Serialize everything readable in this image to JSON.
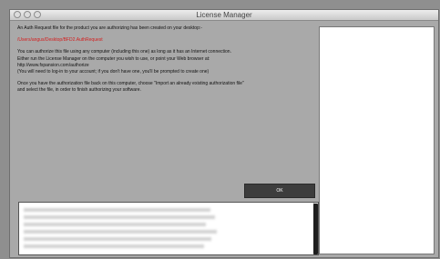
{
  "window": {
    "title": "License Manager"
  },
  "message": {
    "intro": "An Auth Request file for the product you are authorizing has been created on your desktop:-",
    "file_path": "/Users/angus/Desktop/BFD2.AuthRequest",
    "line1": "You can authorize this file using any computer (including this one) as long as it has an Internet connection.",
    "line2": "Either run the License Manager on the computer you wish to use, or point your Web browser at:",
    "url": "http://www.fxpansion.com/authorize",
    "line3": "(You will need to log-in to your account; if you don't have one, you'll be prompted to create one)",
    "line4": "Once you have the authorization file back on this computer, choose \"Import an already existing authorization file\"",
    "line5": "and select the file, in order to finish authorizing your software."
  },
  "buttons": {
    "ok_label": "OK"
  },
  "colors": {
    "path_text": "#d42020",
    "window_bg": "#a9a9a9",
    "ok_button_bg": "#3d3d3d"
  }
}
